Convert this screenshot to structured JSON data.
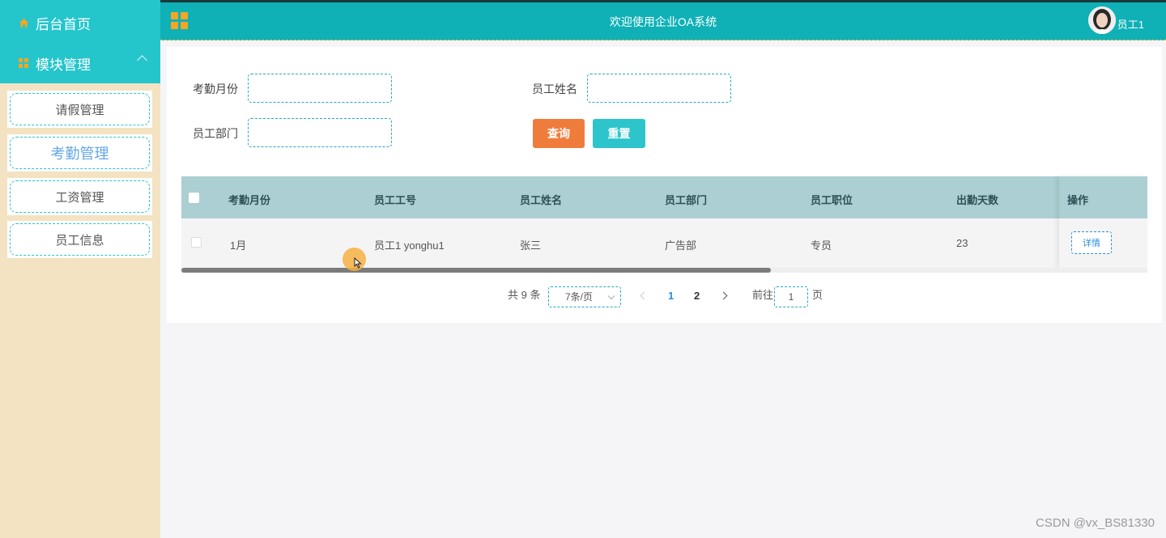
{
  "sidebar": {
    "home_label": "后台首页",
    "module_label": "模块管理",
    "items": [
      {
        "label": "请假管理"
      },
      {
        "label": "考勤管理"
      },
      {
        "label": "工资管理"
      },
      {
        "label": "员工信息"
      }
    ]
  },
  "header": {
    "title": "欢迎使用企业OA系统",
    "user_name": "员工1"
  },
  "filters": {
    "month_label": "考勤月份",
    "name_label": "员工姓名",
    "dept_label": "员工部门",
    "month_value": "",
    "name_value": "",
    "dept_value": "",
    "query_button": "查询",
    "reset_button": "重置"
  },
  "table": {
    "columns": [
      "考勤月份",
      "员工工号",
      "员工姓名",
      "员工部门",
      "员工职位",
      "出勤天数",
      "操作"
    ],
    "rows": [
      {
        "month": "1月",
        "emp_no": "员工1 yonghu1",
        "name": "张三",
        "dept": "广告部",
        "position": "专员",
        "days": "23",
        "action": "详情"
      }
    ],
    "scroll_fraction": 0.61
  },
  "pagination": {
    "total": "共 9 条",
    "page_size": "7条/页",
    "pages": [
      "1",
      "2"
    ],
    "current_page": "1",
    "goto_label": "前往",
    "goto_value": "1",
    "page_suffix": "页"
  },
  "watermark": "CSDN @vx_BS81330",
  "colors": {
    "primary": "#0fb1b6",
    "sidebar_bg": "#f3e3c2",
    "query_button": "#f07c3c",
    "reset_button": "#2dc4cc"
  }
}
